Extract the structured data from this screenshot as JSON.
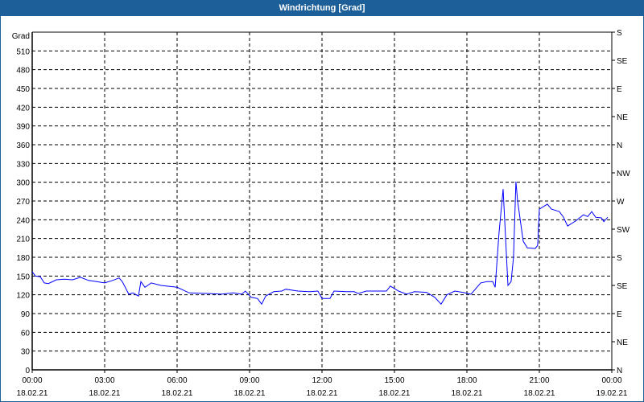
{
  "window_title": "Windrichtung [Grad]",
  "chart_data": {
    "type": "line",
    "title": "Windrichtung [Grad]",
    "ylabel": "Grad",
    "ylim": [
      0,
      540
    ],
    "yticks": [
      0,
      30,
      60,
      90,
      120,
      150,
      180,
      210,
      240,
      270,
      300,
      330,
      360,
      390,
      420,
      450,
      480,
      510
    ],
    "right_axis": {
      "ticks": [
        0,
        45,
        90,
        135,
        180,
        225,
        270,
        315,
        360,
        405,
        450,
        495,
        540
      ],
      "labels": [
        "N",
        "NE",
        "E",
        "SE",
        "S",
        "SW",
        "W",
        "NW",
        "N",
        "NE",
        "E",
        "SE",
        "S"
      ]
    },
    "xlim_hours": [
      0,
      24
    ],
    "xticks": [
      {
        "h": 0,
        "time": "00:00",
        "date": "18.02.21"
      },
      {
        "h": 3,
        "time": "03:00",
        "date": "18.02.21"
      },
      {
        "h": 6,
        "time": "06:00",
        "date": "18.02.21"
      },
      {
        "h": 9,
        "time": "09:00",
        "date": "18.02.21"
      },
      {
        "h": 12,
        "time": "12:00",
        "date": "18.02.21"
      },
      {
        "h": 15,
        "time": "15:00",
        "date": "18.02.21"
      },
      {
        "h": 18,
        "time": "18:00",
        "date": "18.02.21"
      },
      {
        "h": 21,
        "time": "21:00",
        "date": "18.02.21"
      },
      {
        "h": 24,
        "time": "00:00",
        "date": "19.02.21"
      }
    ],
    "grid": true,
    "series": [
      {
        "name": "Windrichtung",
        "color": "#0000ff",
        "x": [
          0,
          0.13,
          0.33,
          0.5,
          0.67,
          1,
          1.33,
          1.67,
          2,
          2.33,
          2.67,
          3,
          3.33,
          3.6,
          3.73,
          4,
          4.17,
          4.4,
          4.5,
          4.67,
          4.93,
          5.33,
          6,
          6.5,
          7.33,
          7.83,
          8.33,
          8.67,
          8.83,
          9.07,
          9.33,
          9.5,
          9.67,
          10,
          10.33,
          10.5,
          11,
          11.5,
          11.83,
          12,
          12.33,
          12.5,
          13,
          13.33,
          13.5,
          13.83,
          14.33,
          14.67,
          14.83,
          15.17,
          15.5,
          15.83,
          16.33,
          16.67,
          16.93,
          17.17,
          17.5,
          17.83,
          18.17,
          18.57,
          18.83,
          19.07,
          19.17,
          19.33,
          19.5,
          19.6,
          19.7,
          19.83,
          19.93,
          20.03,
          20.1,
          20.33,
          20.5,
          20.83,
          20.93,
          21,
          21.33,
          21.5,
          21.83,
          22,
          22.17,
          22.5,
          22.83,
          23,
          23.17,
          23.33,
          23.57,
          23.67,
          23.83
        ],
        "y": [
          157,
          150,
          149,
          139,
          138,
          144,
          145,
          144,
          148,
          143,
          141,
          139,
          143,
          147,
          141,
          121,
          123,
          118,
          141,
          132,
          139,
          135,
          132,
          123,
          122,
          121,
          123,
          121,
          126,
          116,
          114,
          105,
          118,
          125,
          126,
          129,
          126,
          125,
          126,
          114,
          114,
          126,
          125,
          125,
          122,
          126,
          126,
          126,
          134,
          126,
          121,
          125,
          124,
          116,
          105,
          120,
          126,
          124,
          121,
          139,
          141,
          141,
          132,
          219,
          289,
          212,
          135,
          141,
          180,
          301,
          270,
          206,
          195,
          194,
          199,
          257,
          265,
          257,
          253,
          244,
          230,
          238,
          248,
          245,
          253,
          244,
          243,
          237,
          244
        ]
      }
    ]
  }
}
